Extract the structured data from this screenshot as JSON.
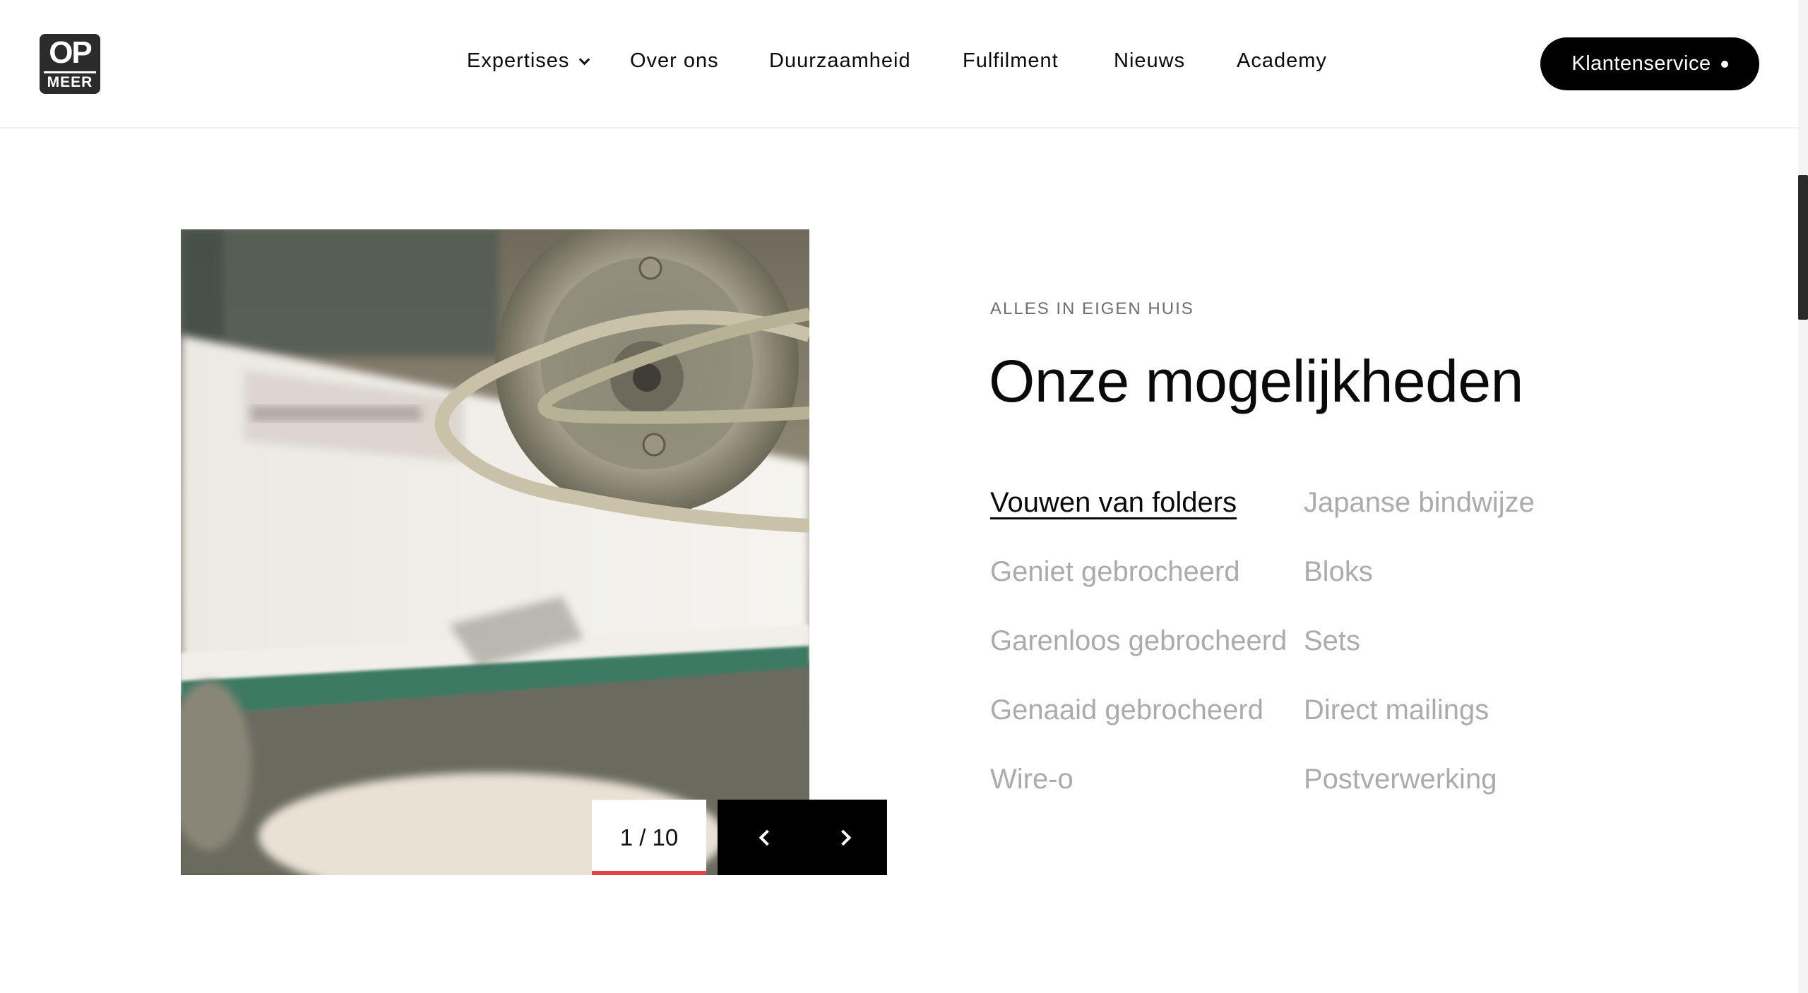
{
  "header": {
    "logo": {
      "line1": "OP",
      "line2": "MEER"
    },
    "nav": [
      {
        "label": "Expertises",
        "has_dropdown": true
      },
      {
        "label": "Over ons"
      },
      {
        "label": "Duurzaamheid"
      },
      {
        "label": "Fulfilment"
      },
      {
        "label": "Nieuws"
      },
      {
        "label": "Academy"
      }
    ],
    "cta_label": "Klantenservice"
  },
  "slider": {
    "counter": "1 / 10",
    "prev_icon": "chevron-left-icon",
    "next_icon": "chevron-right-icon"
  },
  "section": {
    "eyebrow": "ALLES IN EIGEN HUIS",
    "title": "Onze mogelijkheden",
    "options": [
      {
        "label": "Vouwen van folders",
        "active": true
      },
      {
        "label": "Japanse bindwijze",
        "active": false
      },
      {
        "label": "Geniet gebrocheerd",
        "active": false
      },
      {
        "label": "Bloks",
        "active": false
      },
      {
        "label": "Garenloos gebrocheerd",
        "active": false
      },
      {
        "label": "Sets",
        "active": false
      },
      {
        "label": "Genaaid gebrocheerd",
        "active": false
      },
      {
        "label": "Direct mailings",
        "active": false
      },
      {
        "label": "Wire-o",
        "active": false
      },
      {
        "label": "Postverwerking",
        "active": false
      }
    ]
  },
  "colors": {
    "accent_progress": "#e5424d",
    "inactive_option": "#ababab",
    "text": "#0a0a0a"
  }
}
